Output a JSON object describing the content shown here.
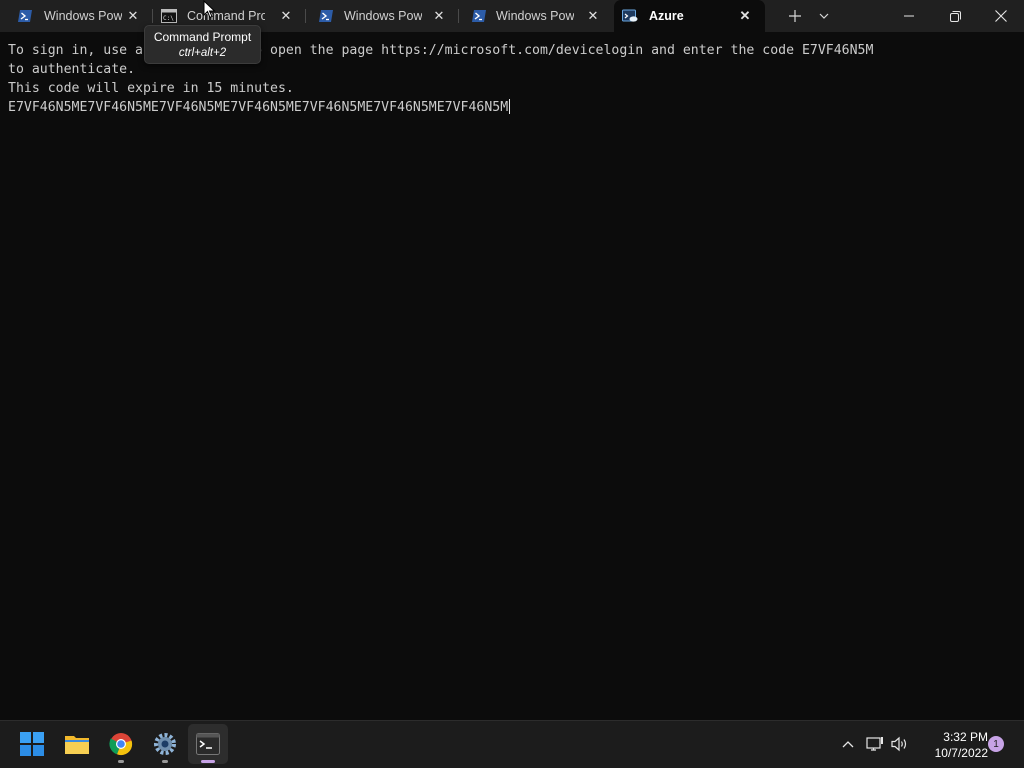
{
  "tabs": [
    {
      "title": "Windows Powe",
      "icon": "powershell-icon"
    },
    {
      "title": "Command Pro",
      "icon": "command-prompt-icon"
    },
    {
      "title": "Windows Powe",
      "icon": "powershell-icon"
    },
    {
      "title": "Windows Powe",
      "icon": "powershell-icon"
    },
    {
      "title": "Azure",
      "icon": "azure-cloud-shell-icon",
      "active": true
    }
  ],
  "tooltip": {
    "title": "Command Prompt",
    "shortcut": "ctrl+alt+2"
  },
  "terminal": {
    "lines": [
      "To sign in, use a web browser to open the page https://microsoft.com/devicelogin and enter the code E7VF46N5M",
      "to authenticate.",
      "This code will expire in 15 minutes.",
      "E7VF46N5ME7VF46N5ME7VF46N5ME7VF46N5ME7VF46N5ME7VF46N5ME7VF46N5M"
    ]
  },
  "taskbar": {
    "apps": [
      "start-icon",
      "file-explorer-icon",
      "chrome-icon",
      "settings-icon",
      "terminal-icon"
    ],
    "tray": [
      "chevron-up-icon",
      "network-icon",
      "volume-icon"
    ],
    "clock": {
      "time": "3:32 PM",
      "date": "10/7/2022"
    },
    "notification_count": "1"
  },
  "colors": {
    "terminal_bg": "#0c0c0c",
    "tabbar_bg": "#202020",
    "taskbar_bg": "#1c1c1c",
    "accent": "#c7a3e6"
  }
}
